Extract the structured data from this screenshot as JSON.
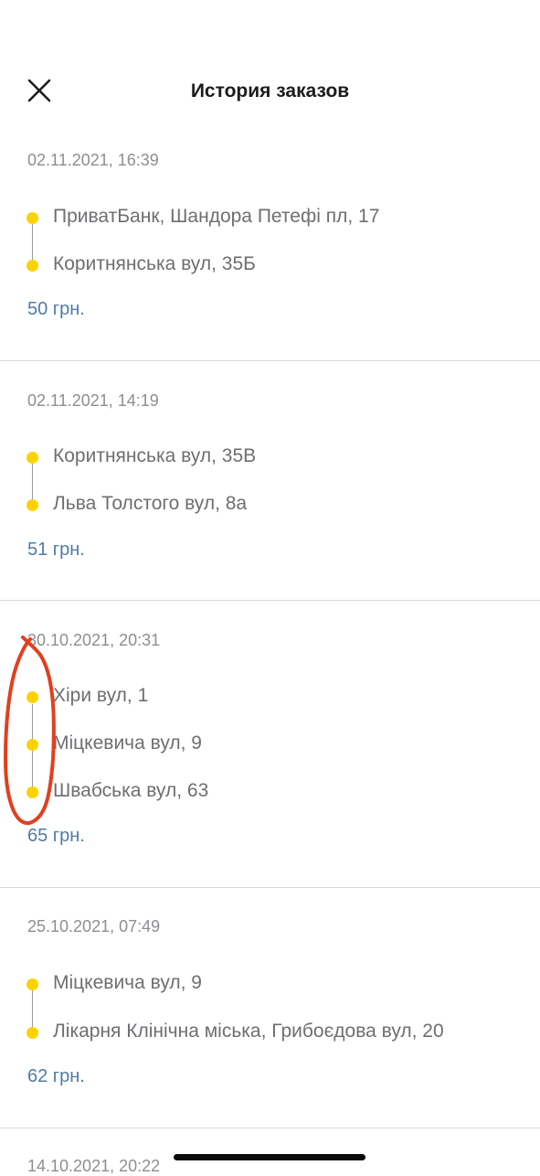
{
  "header": {
    "title": "История заказов",
    "close_icon": "close-icon"
  },
  "colors": {
    "accent_dot": "#fed201",
    "price_text": "#4f7ca6",
    "annotation_stroke": "#e0401f"
  },
  "orders": [
    {
      "date": "02.11.2021, 16:39",
      "stops": [
        "ПриватБанк, Шандора Петефі пл, 17",
        "Коритнянська вул, 35Б"
      ],
      "price": "50 грн."
    },
    {
      "date": "02.11.2021, 14:19",
      "stops": [
        "Коритнянська вул, 35В",
        "Льва Толстого вул, 8а"
      ],
      "price": "51 грн."
    },
    {
      "date": "30.10.2021, 20:31",
      "stops": [
        "Хіри вул, 1",
        "Міцкевича вул, 9",
        "Швабська вул, 63"
      ],
      "price": "65 грн."
    },
    {
      "date": "25.10.2021, 07:49",
      "stops": [
        "Міцкевича вул, 9",
        "Лікарня Клінічна міська, Грибоєдова вул, 20"
      ],
      "price": "62 грн."
    }
  ],
  "next_order_date_partial": "14.10.2021, 20:22"
}
